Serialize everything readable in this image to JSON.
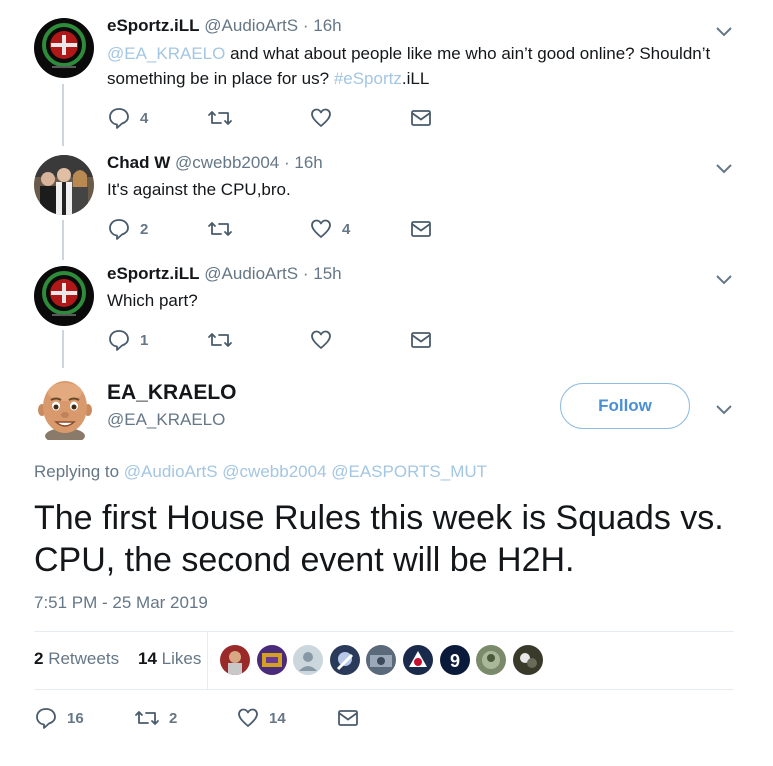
{
  "thread": [
    {
      "name": "eSportz.iLL",
      "handle": "@AudioArtS",
      "dot": "·",
      "time": "16h",
      "text_parts": {
        "mention": "@EA_KRAELO",
        "body": " and what about people like me  who ain’t good online? Shouldn’t something be in place for us? ",
        "hashtag": "#eSportz",
        "tail": ".iLL"
      },
      "reply_count": "4",
      "retweet_count": "",
      "like_count": "",
      "avatar_icon": "green-ring-logo-icon"
    },
    {
      "name": "Chad W",
      "handle": "@cwebb2004",
      "dot": "·",
      "time": "16h",
      "text": "It's against the CPU,bro.",
      "reply_count": "2",
      "retweet_count": "",
      "like_count": "4",
      "avatar_icon": "group-photo-icon"
    },
    {
      "name": "eSportz.iLL",
      "handle": "@AudioArtS",
      "dot": "·",
      "time": "15h",
      "text": "Which part?",
      "reply_count": "1",
      "retweet_count": "",
      "like_count": "",
      "avatar_icon": "green-ring-logo-icon"
    }
  ],
  "main": {
    "name": "EA_KRAELO",
    "handle": "@EA_KRAELO",
    "follow_label": "Follow",
    "replying_prefix": "Replying to ",
    "replying_mentions": "@AudioArtS @cwebb2004 @EASPORTS_MUT",
    "text": "The first House Rules this week is Squads vs. CPU, the second event will be H2H.",
    "timestamp": "7:51 PM - 25 Mar 2019",
    "retweets_count": "2",
    "retweets_label": "Retweets",
    "likes_count": "14",
    "likes_label": "Likes",
    "reply_count": "16",
    "retweet_count": "2",
    "like_count": "14",
    "avatar_icon": "memoji-avatar-icon"
  },
  "colors": {
    "text": "#14171a",
    "muted": "#657786",
    "link": "#a3c6e3",
    "accent": "#4a90d6",
    "border": "#e6ecf0"
  }
}
